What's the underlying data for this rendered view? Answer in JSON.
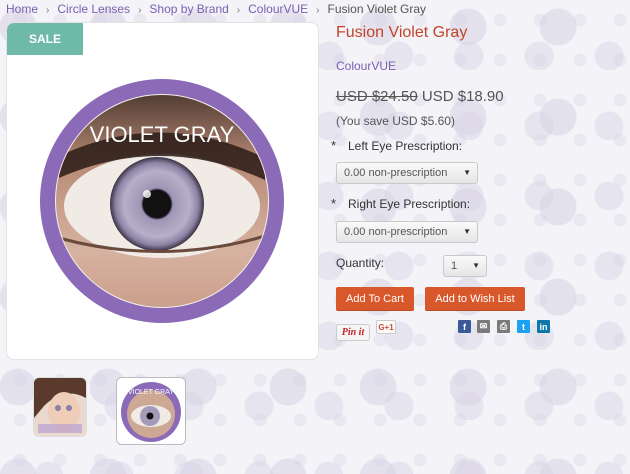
{
  "breadcrumb": {
    "items": [
      "Home",
      "Circle Lenses",
      "Shop by Brand",
      "ColourVUE"
    ],
    "separator": "›",
    "current": "Fusion Violet Gray"
  },
  "product_image": {
    "sale_badge": "SALE",
    "lens_label": "VIOLET GRAY",
    "ring_color": "#8b6ab8"
  },
  "product": {
    "title": "Fusion Violet Gray",
    "brand": "ColourVUE",
    "old_price": "USD $24.50",
    "new_price": "USD $18.90",
    "savings": "(You save USD $5.60)"
  },
  "form": {
    "required_mark": "*",
    "left_eye_label": "Left Eye Prescription:",
    "left_eye_value": "0.00 non-prescription",
    "right_eye_label": "Right Eye Prescription:",
    "right_eye_value": "0.00 non-prescription",
    "quantity_label": "Quantity:",
    "quantity_value": "1"
  },
  "actions": {
    "add_to_cart": "Add To Cart",
    "add_to_wishlist": "Add to Wish List",
    "button_color": "#d9582b"
  },
  "social": {
    "pinit": "Pin it",
    "gplus": "G+1",
    "share_icons": [
      {
        "name": "facebook-icon",
        "glyph": "f",
        "color": "#3b5998"
      },
      {
        "name": "email-icon",
        "glyph": "✉",
        "color": "#7a7a7a"
      },
      {
        "name": "print-icon",
        "glyph": "⎙",
        "color": "#7a7a7a"
      },
      {
        "name": "twitter-icon",
        "glyph": "t",
        "color": "#1da1f2"
      },
      {
        "name": "linkedin-icon",
        "glyph": "in",
        "color": "#0e76a8"
      }
    ]
  },
  "thumbnails": {
    "second_label": "VIOLET GRAY"
  }
}
